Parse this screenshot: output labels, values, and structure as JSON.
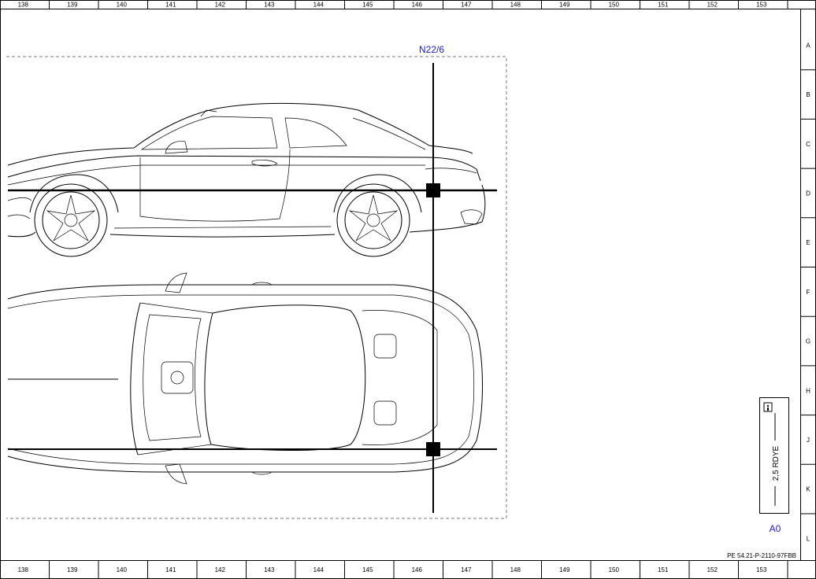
{
  "grid": {
    "columns": [
      "138",
      "139",
      "140",
      "141",
      "142",
      "143",
      "144",
      "145",
      "146",
      "147",
      "148",
      "149",
      "150",
      "151",
      "152",
      "153"
    ],
    "rows": [
      "A",
      "B",
      "C",
      "D",
      "E",
      "F",
      "G",
      "H",
      "J",
      "K",
      "L"
    ]
  },
  "component": {
    "label": "N22/6"
  },
  "wire": {
    "spec": "2,5 RDYE",
    "info_icon": "info-icon"
  },
  "connector": {
    "label": "A0"
  },
  "document": {
    "reference": "PE 54.21-P-2110-97FBB"
  },
  "colors": {
    "label_blue": "#1a1acc",
    "line": "#000000",
    "dash": "#777777"
  }
}
